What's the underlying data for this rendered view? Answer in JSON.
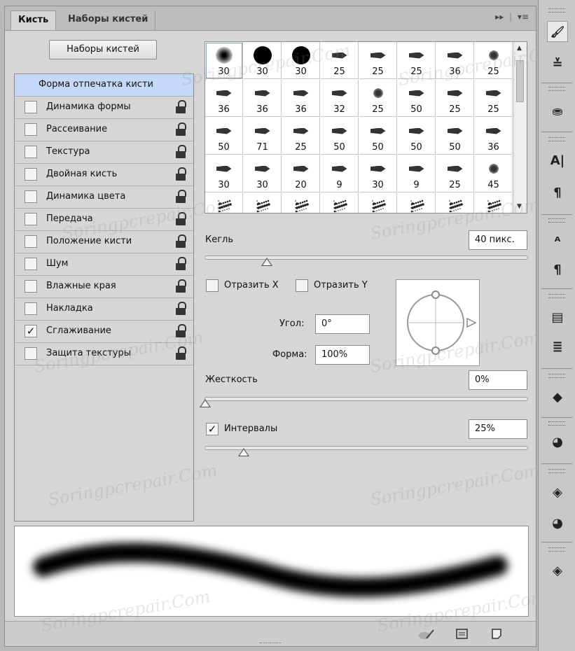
{
  "tabs": [
    {
      "label": "Кисть",
      "active": true
    },
    {
      "label": "Наборы кистей",
      "active": false
    }
  ],
  "presets_button": "Наборы кистей",
  "settings": [
    {
      "label": "Форма отпечатка кисти",
      "checkbox": false,
      "selected": true,
      "lock": false
    },
    {
      "label": "Динамика формы",
      "checkbox": true,
      "checked": false,
      "lock": true
    },
    {
      "label": "Рассеивание",
      "checkbox": true,
      "checked": false,
      "lock": true
    },
    {
      "label": "Текстура",
      "checkbox": true,
      "checked": false,
      "lock": true
    },
    {
      "label": "Двойная кисть",
      "checkbox": true,
      "checked": false,
      "lock": true
    },
    {
      "label": "Динамика цвета",
      "checkbox": true,
      "checked": false,
      "lock": true
    },
    {
      "label": "Передача",
      "checkbox": true,
      "checked": false,
      "lock": true
    },
    {
      "label": "Положение кисти",
      "checkbox": true,
      "checked": false,
      "lock": true
    },
    {
      "label": "Шум",
      "checkbox": true,
      "checked": false,
      "lock": true
    },
    {
      "label": "Влажные края",
      "checkbox": true,
      "checked": false,
      "lock": true
    },
    {
      "label": "Накладка",
      "checkbox": true,
      "checked": false,
      "lock": true
    },
    {
      "label": "Сглаживание",
      "checkbox": true,
      "checked": true,
      "lock": true
    },
    {
      "label": "Защита текстуры",
      "checkbox": true,
      "checked": false,
      "lock": true
    }
  ],
  "brush_tips": [
    {
      "size": "30",
      "shape": "soft"
    },
    {
      "size": "30",
      "shape": "hard"
    },
    {
      "size": "30",
      "shape": "hard"
    },
    {
      "size": "25",
      "shape": "tip"
    },
    {
      "size": "25",
      "shape": "tip"
    },
    {
      "size": "25",
      "shape": "tip"
    },
    {
      "size": "36",
      "shape": "tip"
    },
    {
      "size": "25",
      "shape": "fan"
    },
    {
      "size": "36",
      "shape": "tip"
    },
    {
      "size": "36",
      "shape": "tip"
    },
    {
      "size": "36",
      "shape": "tip"
    },
    {
      "size": "32",
      "shape": "tip"
    },
    {
      "size": "25",
      "shape": "fan"
    },
    {
      "size": "50",
      "shape": "tip"
    },
    {
      "size": "25",
      "shape": "tip"
    },
    {
      "size": "25",
      "shape": "tip"
    },
    {
      "size": "50",
      "shape": "tip"
    },
    {
      "size": "71",
      "shape": "tip"
    },
    {
      "size": "25",
      "shape": "tip"
    },
    {
      "size": "50",
      "shape": "tip"
    },
    {
      "size": "50",
      "shape": "tip"
    },
    {
      "size": "50",
      "shape": "tip"
    },
    {
      "size": "50",
      "shape": "tip"
    },
    {
      "size": "36",
      "shape": "tip"
    },
    {
      "size": "30",
      "shape": "tip"
    },
    {
      "size": "30",
      "shape": "tip"
    },
    {
      "size": "20",
      "shape": "tip"
    },
    {
      "size": "9",
      "shape": "tip"
    },
    {
      "size": "30",
      "shape": "tip"
    },
    {
      "size": "9",
      "shape": "tip"
    },
    {
      "size": "25",
      "shape": "tip"
    },
    {
      "size": "45",
      "shape": "fan"
    },
    {
      "size": "",
      "shape": "spatter"
    },
    {
      "size": "",
      "shape": "spatter"
    },
    {
      "size": "",
      "shape": "spatter"
    },
    {
      "size": "",
      "shape": "spatter"
    },
    {
      "size": "",
      "shape": "spatter"
    },
    {
      "size": "",
      "shape": "spatter"
    },
    {
      "size": "",
      "shape": "spatter"
    },
    {
      "size": "",
      "shape": "spatter"
    }
  ],
  "size": {
    "label": "Кегль",
    "value": "40 пикс.",
    "slider_fraction": 0.19
  },
  "flip": {
    "x_label": "Отразить X",
    "y_label": "Отразить Y",
    "x_checked": false,
    "y_checked": false
  },
  "angle": {
    "label": "Угол:",
    "value": "0°"
  },
  "roundness": {
    "label": "Форма:",
    "value": "100%"
  },
  "hardness": {
    "label": "Жесткость",
    "value": "0%",
    "slider_fraction": 0.0
  },
  "spacing": {
    "label": "Интервалы",
    "checked": true,
    "value": "25%",
    "slider_fraction": 0.12
  },
  "watermark": "Soringpcrepair.Com",
  "dock_icons": [
    "brush-icon",
    "brush-settings-icon",
    "clone-source-icon",
    "character-icon",
    "paragraph-icon",
    "character-styles-icon",
    "paragraph-styles-icon",
    "tool-presets-icon",
    "layer-comps-icon",
    "3d-icon",
    "channels-icon",
    "layers-icon"
  ]
}
